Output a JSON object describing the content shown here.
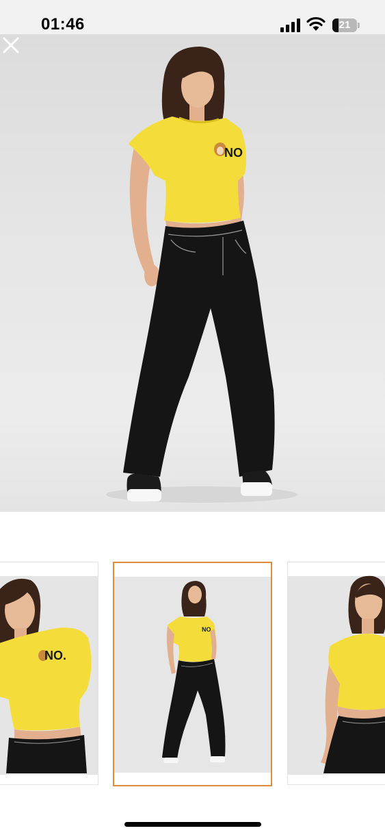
{
  "status_bar": {
    "time": "01:46",
    "battery_level": "21",
    "signal_icon": "cellular-signal-icon",
    "wifi_icon": "wifi-icon",
    "battery_icon": "battery-icon"
  },
  "viewer": {
    "close_icon": "close-icon",
    "shirt_print": "NO",
    "selected_thumbnail_index": 1,
    "thumbnail_count": 3
  },
  "colors": {
    "accent_selected_border": "#e08a3c",
    "shirt": "#f4dd3a",
    "jeans": "#151515"
  }
}
